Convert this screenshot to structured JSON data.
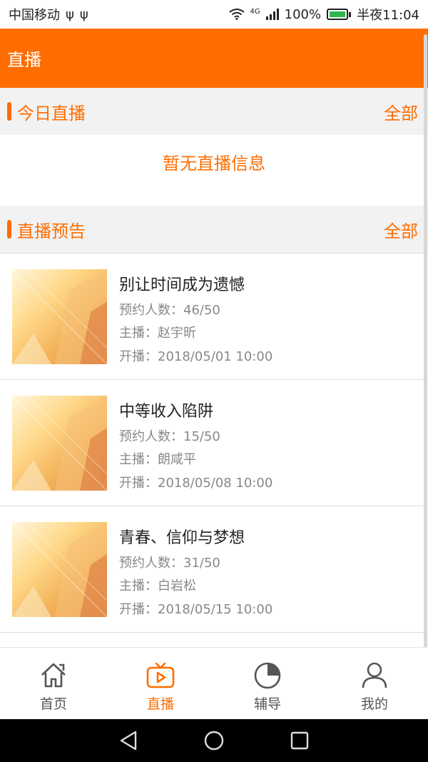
{
  "status_bar": {
    "carrier": "中国移动",
    "signal_text": "4G",
    "battery_text": "100%",
    "time": "半夜11:04",
    "battery_level": 1.0
  },
  "app_bar": {
    "title": "直播"
  },
  "today": {
    "title": "今日直播",
    "more_label": "全部",
    "empty_text": "暂无直播信息"
  },
  "preview": {
    "title": "直播预告",
    "more_label": "全部",
    "items": [
      {
        "title": "别让时间成为遗憾",
        "reserve": "预约人数：46/50",
        "host": "主播：赵宇昕",
        "start": "开播：2018/05/01 10:00"
      },
      {
        "title": "中等收入陷阱",
        "reserve": "预约人数：15/50",
        "host": "主播：朗咸平",
        "start": "开播：2018/05/08 10:00"
      },
      {
        "title": "青春、信仰与梦想",
        "reserve": "预约人数：31/50",
        "host": "主播：白岩松",
        "start": "开播：2018/05/15 10:00"
      }
    ]
  },
  "tabs": [
    {
      "label": "首页",
      "icon": "home-icon",
      "active": false
    },
    {
      "label": "直播",
      "icon": "tv-play-icon",
      "active": true
    },
    {
      "label": "辅导",
      "icon": "pie-chart-icon",
      "active": false
    },
    {
      "label": "我的",
      "icon": "user-icon",
      "active": false
    }
  ],
  "colors": {
    "accent": "#ff6d00",
    "tab_inactive": "#555555",
    "meta_text": "#888888"
  }
}
